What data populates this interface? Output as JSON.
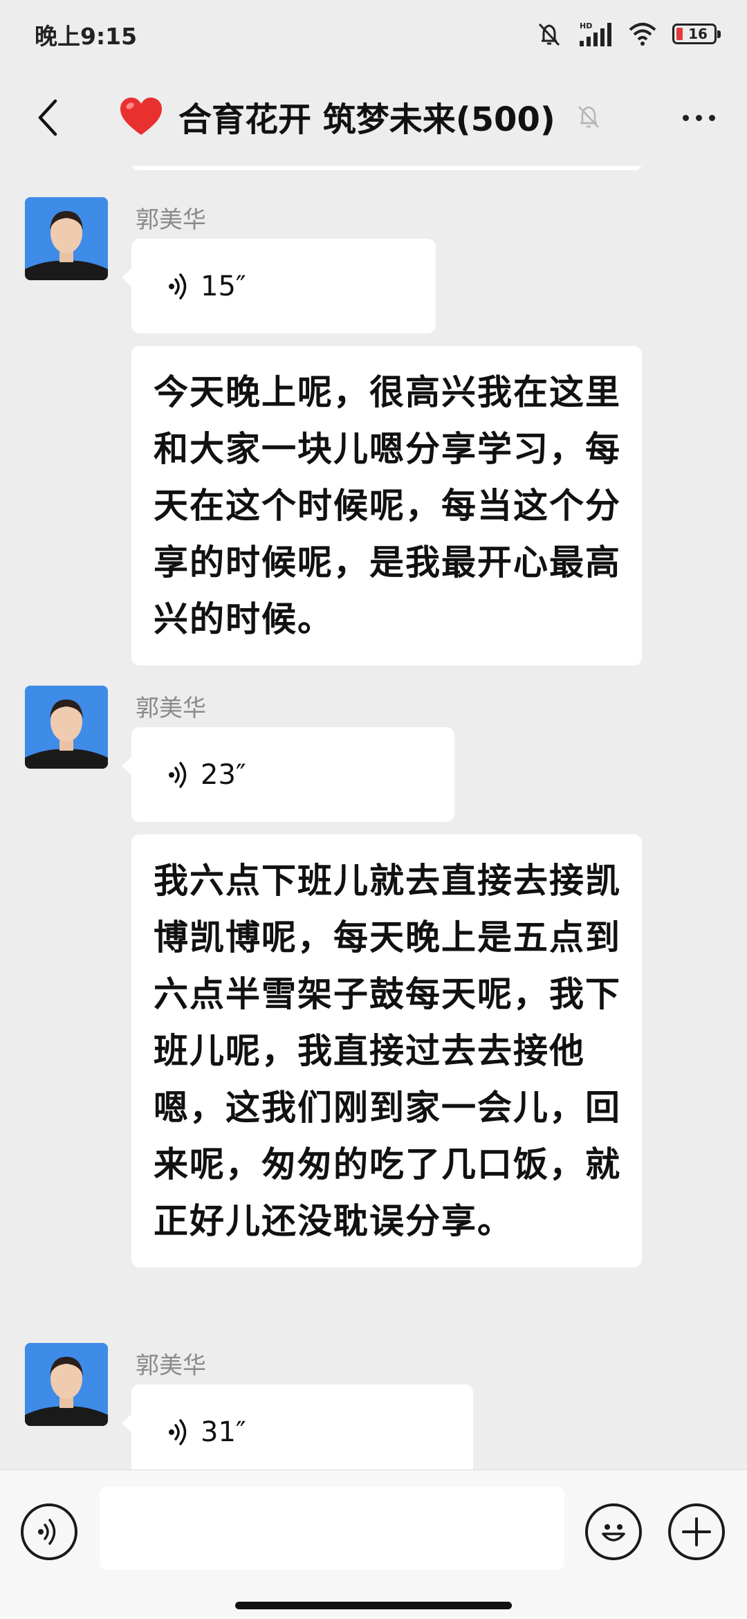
{
  "status_bar": {
    "time": "晚上9:15",
    "icons": [
      "mute-icon",
      "hd-signal-icon",
      "wifi-icon",
      "battery-icon"
    ],
    "battery_level": "16",
    "battery_color": "#e23b3b"
  },
  "header": {
    "title": "合育花开 筑梦未来(500)",
    "emoji": "heart-icon",
    "back_icon": "chevron-left-icon",
    "muted": true,
    "more_icon": "more-dots-icon"
  },
  "messages": [
    {
      "sender": "郭美华",
      "voice_duration": "15″",
      "transcript": "今天晚上呢，很高兴我在这里和大家一块儿嗯分享学习，每天在这个时候呢，每当这个分享的时候呢，是我最开心最高兴的时候。"
    },
    {
      "sender": "郭美华",
      "voice_duration": "23″",
      "transcript": "我六点下班儿就去直接去接凯博凯博呢，每天晚上是五点到六点半雪架子鼓每天呢，我下班儿呢，我直接过去去接他嗯，这我们刚到家一会儿，回来呢，匆匆的吃了几口饭，就正好儿还没耽误分享。"
    },
    {
      "sender": "郭美华",
      "voice_duration": "31″",
      "transcript": ""
    }
  ],
  "input_bar": {
    "voice_toggle_icon": "voice-input-icon",
    "input_value": "",
    "emoji_icon": "emoji-icon",
    "add_icon": "plus-icon"
  },
  "colors": {
    "background": "#ededed",
    "bubble": "#ffffff",
    "name_text": "#8a8a8a",
    "heart": "#e8312f"
  }
}
